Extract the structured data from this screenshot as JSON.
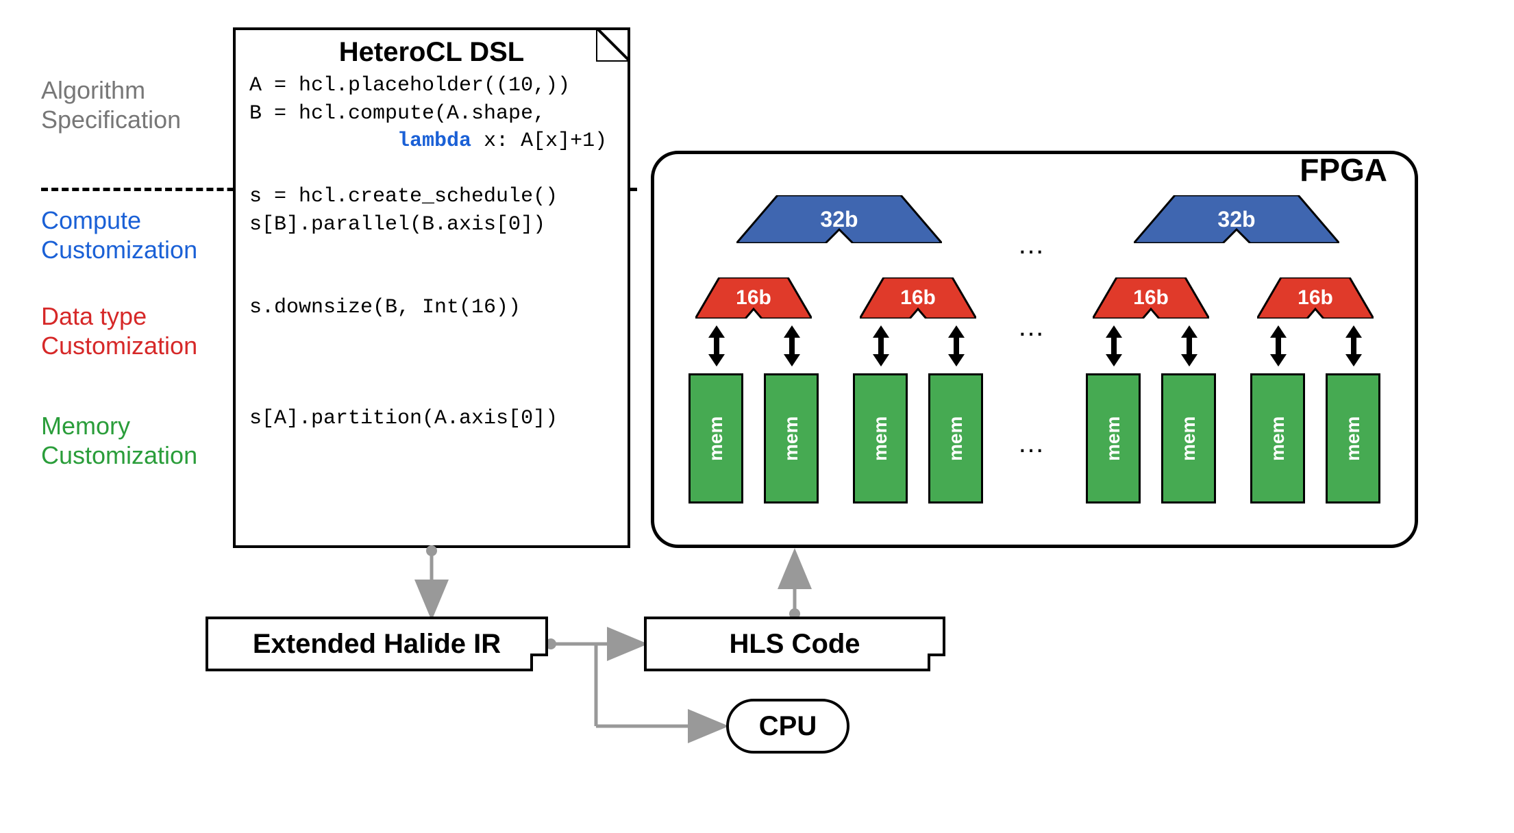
{
  "labels": {
    "algorithm": "Algorithm\nSpecification",
    "compute": "Compute\nCustomization",
    "datatype": "Data type\nCustomization",
    "memory": "Memory\nCustomization"
  },
  "dsl": {
    "title": "HeteroCL DSL",
    "code_line1": "A = hcl.placeholder((10,))",
    "code_line2": "B = hcl.compute(A.shape,",
    "code_line3_pre": "            ",
    "code_line3_kw": "lambda",
    "code_line3_post": " x: A[x]+1)",
    "code_line4": "s = hcl.create_schedule()",
    "code_line5": "s[B].parallel(B.axis[0])",
    "code_line6": "s.downsize(B, Int(16))",
    "code_line7": "s[A].partition(A.axis[0])"
  },
  "flow": {
    "ir": "Extended Halide IR",
    "hls": "HLS Code",
    "cpu": "CPU"
  },
  "fpga": {
    "title": "FPGA",
    "blue": "32b",
    "red": "16b",
    "mem": "mem",
    "ellipsis": "…"
  }
}
